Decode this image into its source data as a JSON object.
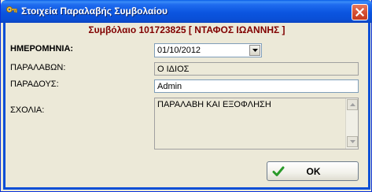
{
  "window": {
    "title": "Στοιχεία Παραλαβής Συμβολαίου",
    "contract_heading": "Συμβόλαιο 101723825 [ ΝΤΑΦΟΣ ΙΩΑΝΝΗΣ ]"
  },
  "form": {
    "date_label": "ΗΜΕΡΟΜΗΝΙΑ:",
    "date_value": "01/10/2012",
    "receiver_label": "ΠΑΡΑΛΑΒΩΝ:",
    "receiver_value": "Ο ΙΔΙΟΣ",
    "deliverer_label": "ΠΑΡΑΔΟΥΣ:",
    "deliverer_value": "Admin",
    "comments_label": "ΣΧΟΛΙΑ:",
    "comments_value": "ΠΑΡΑΛΑΒΗ ΚΑΙ ΕΞΟΦΛΗΣΗ"
  },
  "buttons": {
    "ok_label": "OK"
  },
  "icons": {
    "app": "key-icon",
    "close": "close-icon",
    "ok": "checkmark-icon",
    "dropdown": "chevron-down-icon"
  }
}
